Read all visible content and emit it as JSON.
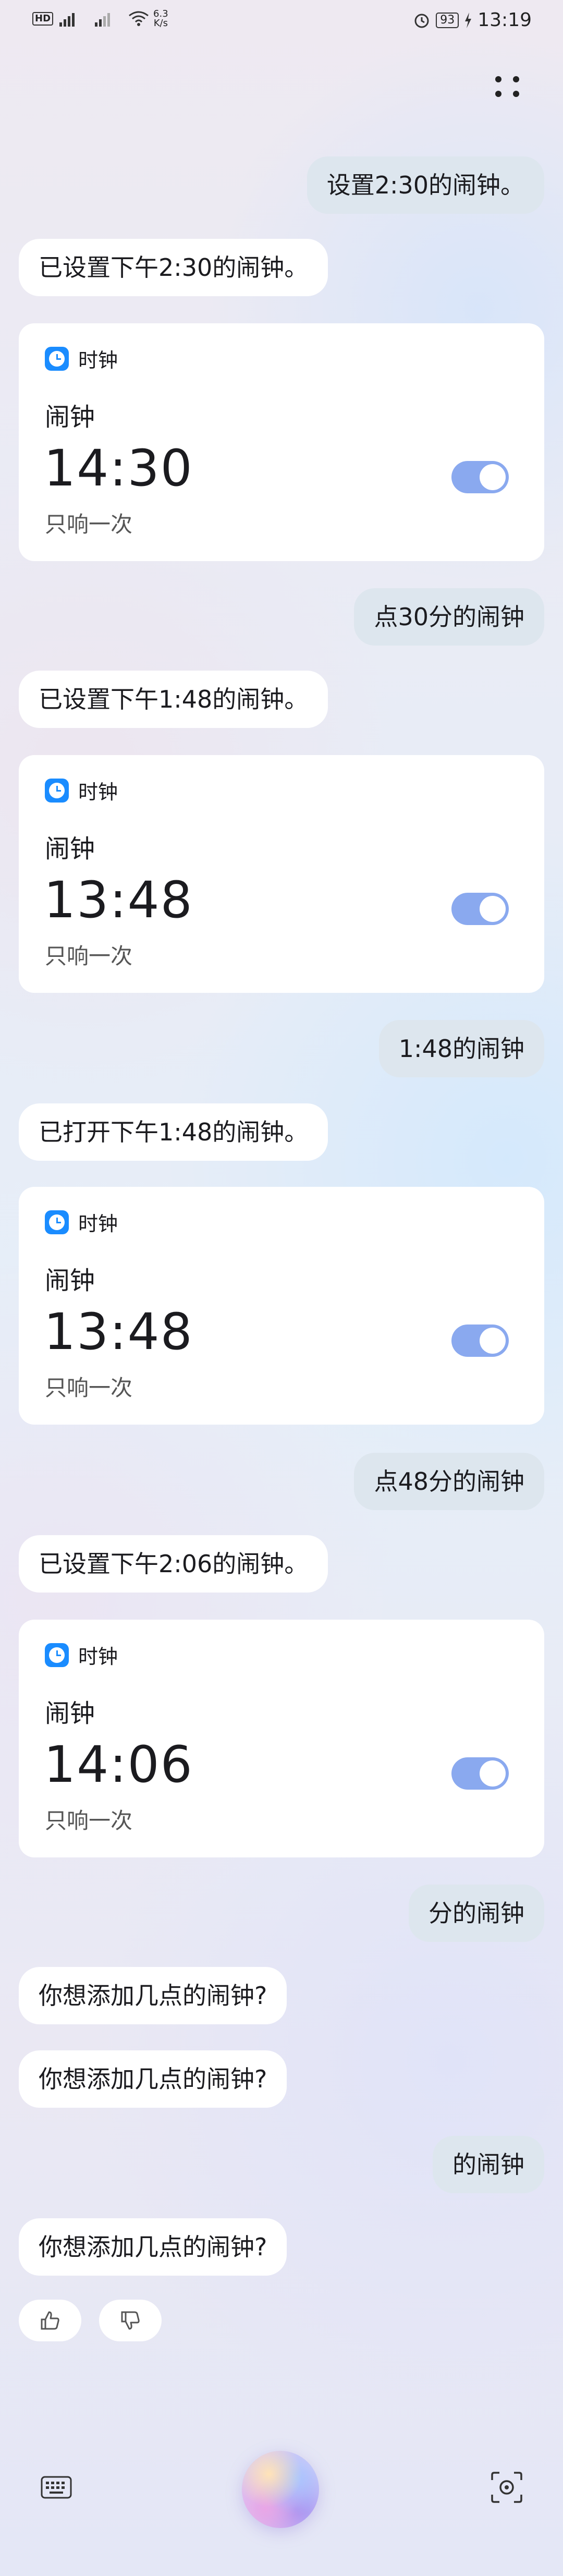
{
  "status_bar": {
    "hd": "HD",
    "net_speed_value": "6.3",
    "net_speed_unit": "K/s",
    "battery": "93",
    "time": "13:19"
  },
  "conversation": {
    "user_1": "设置2:30的闹钟。",
    "reply_1": "已设置下午2:30的闹钟。",
    "user_2": "点30分的闹钟",
    "reply_2": "已设置下午1:48的闹钟。",
    "user_3": "1:48的闹钟",
    "reply_3": "已打开下午1:48的闹钟。",
    "user_4": "点48分的闹钟",
    "reply_4": "已设置下午2:06的闹钟。",
    "user_5": "分的闹钟",
    "reply_5a": "你想添加几点的闹钟?",
    "reply_5b": "你想添加几点的闹钟?",
    "user_6": "的闹钟",
    "reply_6": "你想添加几点的闹钟?"
  },
  "cards": [
    {
      "app_name": "时钟",
      "label": "闹钟",
      "time": "14:30",
      "repeat": "只响一次",
      "enabled": true
    },
    {
      "app_name": "时钟",
      "label": "闹钟",
      "time": "13:48",
      "repeat": "只响一次",
      "enabled": true
    },
    {
      "app_name": "时钟",
      "label": "闹钟",
      "time": "13:48",
      "repeat": "只响一次",
      "enabled": true
    },
    {
      "app_name": "时钟",
      "label": "闹钟",
      "time": "14:06",
      "repeat": "只响一次",
      "enabled": true
    }
  ],
  "colors": {
    "toggle_on": "#8aa9ef",
    "clock_icon": "#1a8cff",
    "user_bubble": "#dde6ee"
  },
  "icons": {
    "menu": "dots-grid-icon",
    "thumbs_up": "thumbs-up-icon",
    "thumbs_down": "thumbs-down-icon",
    "keyboard": "keyboard-icon",
    "assistant": "assistant-orb-icon",
    "camera": "camera-scan-icon"
  }
}
